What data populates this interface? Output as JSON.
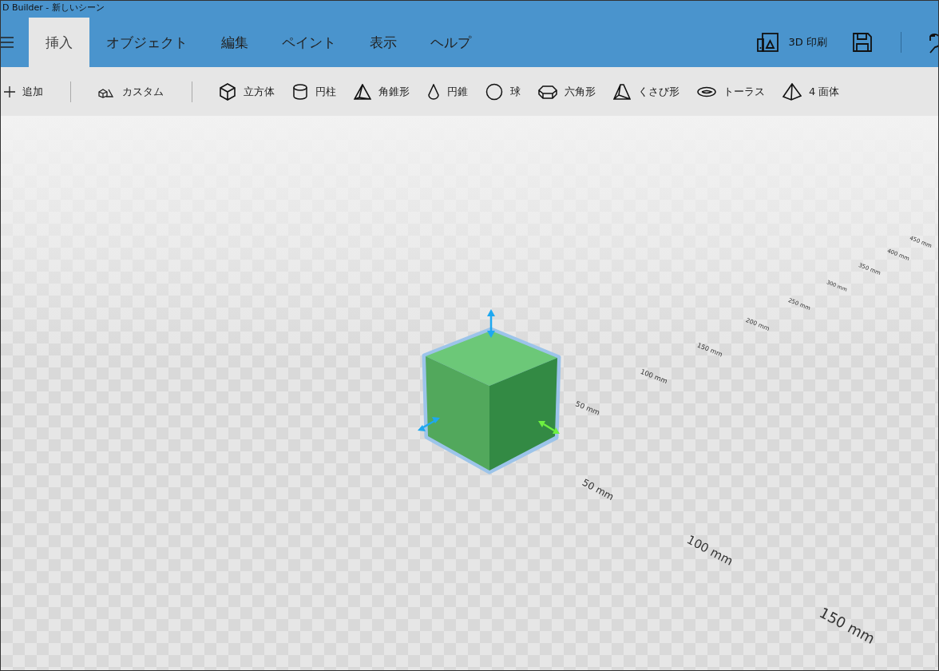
{
  "window": {
    "title": "D Builder - 新しいシーン"
  },
  "tabs": [
    {
      "label": "挿入",
      "selected": true
    },
    {
      "label": "オブジェクト",
      "selected": false
    },
    {
      "label": "編集",
      "selected": false
    },
    {
      "label": "ペイント",
      "selected": false
    },
    {
      "label": "表示",
      "selected": false
    },
    {
      "label": "ヘルプ",
      "selected": false
    }
  ],
  "header_actions": {
    "print_label": "3D 印刷"
  },
  "toolbar": {
    "add_label": "追加",
    "custom_label": "カスタム",
    "shapes": [
      {
        "label": "立方体"
      },
      {
        "label": "円柱"
      },
      {
        "label": "角錐形"
      },
      {
        "label": "円錐"
      },
      {
        "label": "球"
      },
      {
        "label": "六角形"
      },
      {
        "label": "くさび形"
      },
      {
        "label": "トーラス"
      },
      {
        "label": "4 面体"
      }
    ]
  },
  "viewport": {
    "far_axis_labels": [
      "50 mm",
      "100 mm",
      "150 mm",
      "200 mm",
      "250 mm",
      "300 mm",
      "350 mm",
      "400 mm",
      "450 mm"
    ],
    "near_axis_labels": [
      "50 mm",
      "100 mm",
      "150 mm"
    ]
  }
}
